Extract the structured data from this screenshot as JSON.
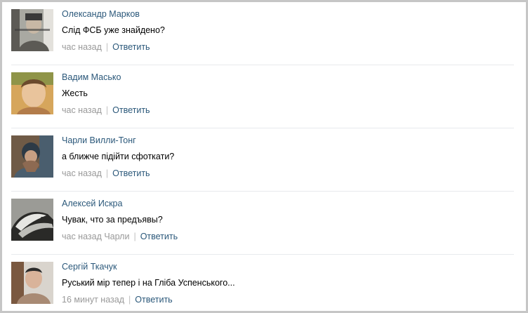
{
  "comments": [
    {
      "author": "Олександр Марков",
      "text": "Слід ФСБ уже знайдено?",
      "time": "час назад",
      "reply": "Ответить",
      "avatar_colors": [
        "#a9a9a2",
        "#5c5a55",
        "#e3e1dc",
        "#3a3a3a",
        "#c8b8a5"
      ]
    },
    {
      "author": "Вадим Масько",
      "text": "Жесть",
      "time": "час назад",
      "reply": "Ответить",
      "avatar_colors": [
        "#d6a65c",
        "#8f9448",
        "#e9c49c",
        "#6b4a2c",
        "#b37c4a"
      ]
    },
    {
      "author": "Чарли Вилли-Тонг",
      "text": "а ближче підійти сфоткати?",
      "time": "час назад",
      "reply": "Ответить",
      "avatar_colors": [
        "#6f5a46",
        "#4a5e6e",
        "#c79f83",
        "#2d3a46",
        "#8d6a52"
      ]
    },
    {
      "author": "Алексей Искра",
      "text": "Чувак, что за предъявы?",
      "time": "час назад Чарли",
      "reply": "Ответить",
      "avatar_colors": [
        "#9b9b96",
        "#4b4b46",
        "#e6e6e2",
        "#2a2a28",
        "#bdbdb8"
      ]
    },
    {
      "author": "Сергій Ткачук",
      "text": "Руський мір тепер і на Гліба Успенського...",
      "time": "16 минут назад",
      "reply": "Ответить",
      "avatar_colors": [
        "#7a5840",
        "#d9d4cd",
        "#d9b39a",
        "#2b2b2b",
        "#a88a74"
      ]
    }
  ]
}
